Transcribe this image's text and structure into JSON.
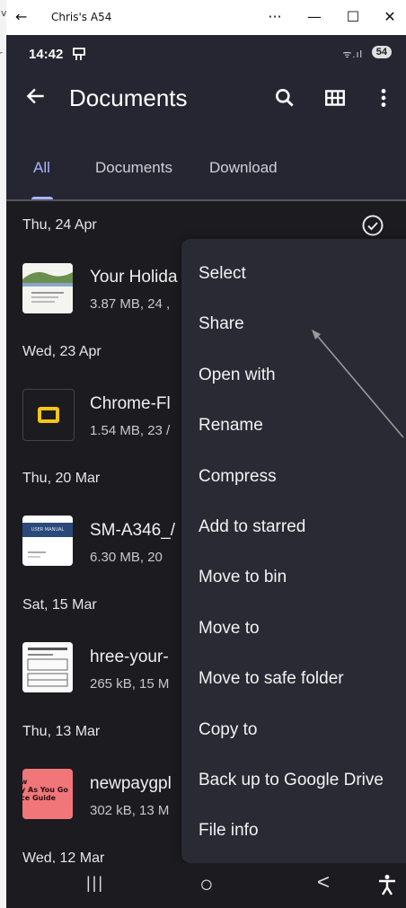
{
  "left_strip": {
    "top_text": "iv",
    "mid_text": "r"
  },
  "window": {
    "title": "Chris's A54",
    "controls": {
      "more": "···",
      "minimize": "—",
      "maximize": "☐",
      "close": "✕"
    },
    "back_glyph": "←"
  },
  "status_bar": {
    "time": "14:42",
    "signal": "ᯤ.ıl",
    "battery": "54"
  },
  "app_bar": {
    "title": "Documents",
    "icons": [
      "back-arrow-icon",
      "search-icon",
      "grid-view-icon",
      "more-vert-icon"
    ]
  },
  "tabs": [
    {
      "label": "All",
      "active": true
    },
    {
      "label": "Documents",
      "active": false
    },
    {
      "label": "Download",
      "active": false
    }
  ],
  "file_list": [
    {
      "date": "Thu, 24 Apr",
      "name": "Your Holida",
      "meta": "3.87 MB, 24 ,"
    },
    {
      "date": "Wed, 23 Apr",
      "name": "Chrome-Fl",
      "meta": "1.54 MB, 23 /"
    },
    {
      "date": "Thu, 20 Mar",
      "name": "SM-A346_/",
      "meta": "6.30 MB, 20",
      "thumb_text": "USER MANUAL"
    },
    {
      "date": "Sat, 15 Mar",
      "name": "hree-your-",
      "meta": "265 kB, 15 M"
    },
    {
      "date": "Thu, 13 Mar",
      "name": "newpaygpl",
      "meta": "302 kB, 13 M",
      "thumb_text": "w\ny As You Go\nce Guide"
    }
  ],
  "trailing_date": "Wed, 12 Mar",
  "context_menu": {
    "items": [
      "Select",
      "Share",
      "Open with",
      "Rename",
      "Compress",
      "Add to starred",
      "Move to bin",
      "Move to",
      "Move to safe folder",
      "Copy to",
      "Back up to Google Drive",
      "File info"
    ]
  },
  "nav_bar": {
    "recents": "|||",
    "home": "○",
    "back": "<"
  },
  "colors": {
    "background": "#1c1b1f",
    "app_bar": "#262632",
    "menu": "#2a2a35",
    "accent": "#aab4ff"
  }
}
